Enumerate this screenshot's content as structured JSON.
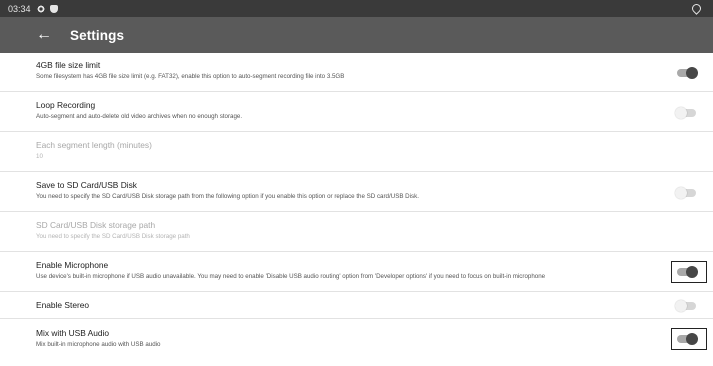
{
  "status_bar": {
    "time": "03:34",
    "icons": [
      "gear-icon",
      "shield-icon",
      "wifi-icon"
    ]
  },
  "app_bar": {
    "back_icon": "←",
    "title": "Settings"
  },
  "settings": [
    {
      "title": "4GB file size limit",
      "subtitle": "Some filesystem has 4GB file size limit (e.g. FAT32), enable this option to auto-segment recording file into 3.5GB",
      "toggle": "on",
      "enabled": true
    },
    {
      "title": "Loop Recording",
      "subtitle": "Auto-segment and auto-delete old video archives when no enough storage.",
      "toggle": "off",
      "enabled": true
    },
    {
      "title": "Each segment length (minutes)",
      "subtitle": "10",
      "enabled": false
    },
    {
      "title": "Save to SD Card/USB Disk",
      "subtitle": "You need to specify the SD Card/USB Disk storage path from the following option if you enable this option or replace the SD card/USB Disk.",
      "toggle": "off",
      "enabled": true
    },
    {
      "title": "SD Card/USB Disk storage path",
      "subtitle": "You need to specify the SD Card/USB Disk storage path",
      "enabled": false
    },
    {
      "title": "Enable Microphone",
      "subtitle": "Use device's built-in microphone if USB audio unavailable. You may need to enable 'Disable USB audio routing' option from 'Developer options' if you need to focus on built-in microphone",
      "toggle": "on",
      "enabled": true,
      "highlighted": true
    },
    {
      "title": "Enable Stereo",
      "toggle": "off",
      "enabled": true
    },
    {
      "title": "Mix with USB Audio",
      "subtitle": "Mix built-in microphone audio with USB audio",
      "toggle": "on",
      "enabled": true,
      "highlighted": true
    }
  ]
}
